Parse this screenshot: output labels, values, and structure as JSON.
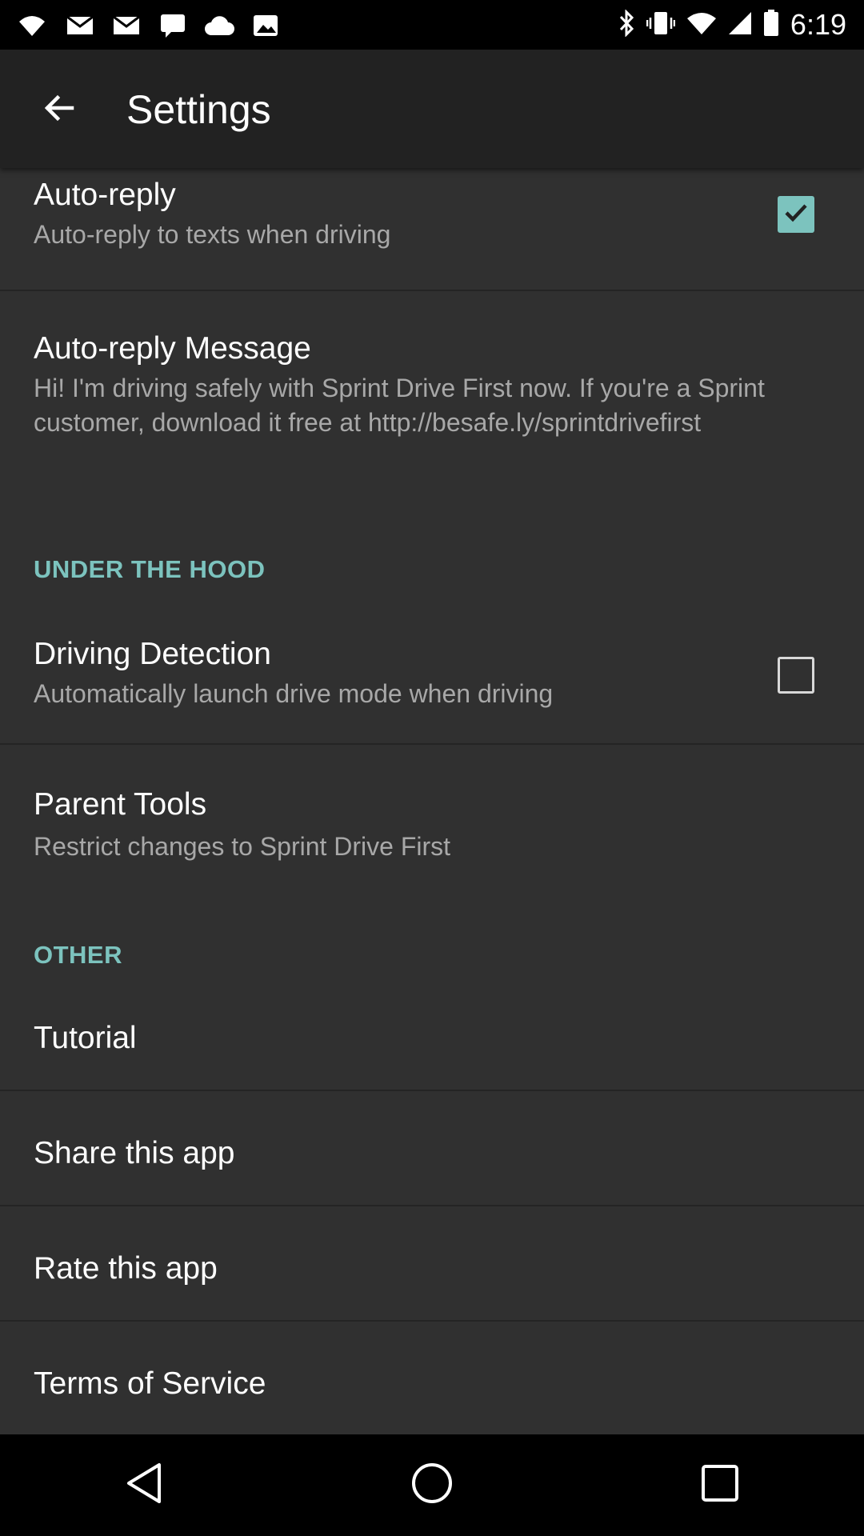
{
  "status_bar": {
    "time": "6:19",
    "notifications": [
      "wifi-icon",
      "mail-icon",
      "mail-icon",
      "message-icon",
      "cloud-icon",
      "photo-icon"
    ],
    "status_icons": [
      "bluetooth-icon",
      "vibrate-icon",
      "wifi-icon",
      "signal-icon",
      "battery-icon"
    ]
  },
  "app_bar": {
    "title": "Settings",
    "back_icon": "arrow-back-icon"
  },
  "colors": {
    "accent": "#7cc3be",
    "background": "#303030",
    "app_bar": "#222222"
  },
  "settings": {
    "auto_reply": {
      "title": "Auto-reply",
      "summary": "Auto-reply to texts when driving",
      "checked": true
    },
    "auto_reply_message": {
      "title": "Auto-reply Message",
      "summary": "Hi! I'm driving safely with Sprint Drive First now. If you're a Sprint customer, download it free at http://besafe.ly/sprintdrivefirst"
    },
    "under_the_hood_header": "UNDER THE HOOD",
    "driving_detection": {
      "title": "Driving Detection",
      "summary": "Automatically launch drive mode when driving",
      "checked": false
    },
    "parent_tools": {
      "title": "Parent Tools",
      "summary": "Restrict changes to Sprint Drive First"
    },
    "other_header": "OTHER",
    "tutorial": "Tutorial",
    "share_app": "Share this app",
    "rate_app": "Rate this app",
    "terms": "Terms of Service"
  },
  "nav_bar": {
    "back": "nav-back-icon",
    "home": "nav-home-icon",
    "recents": "nav-recents-icon"
  }
}
